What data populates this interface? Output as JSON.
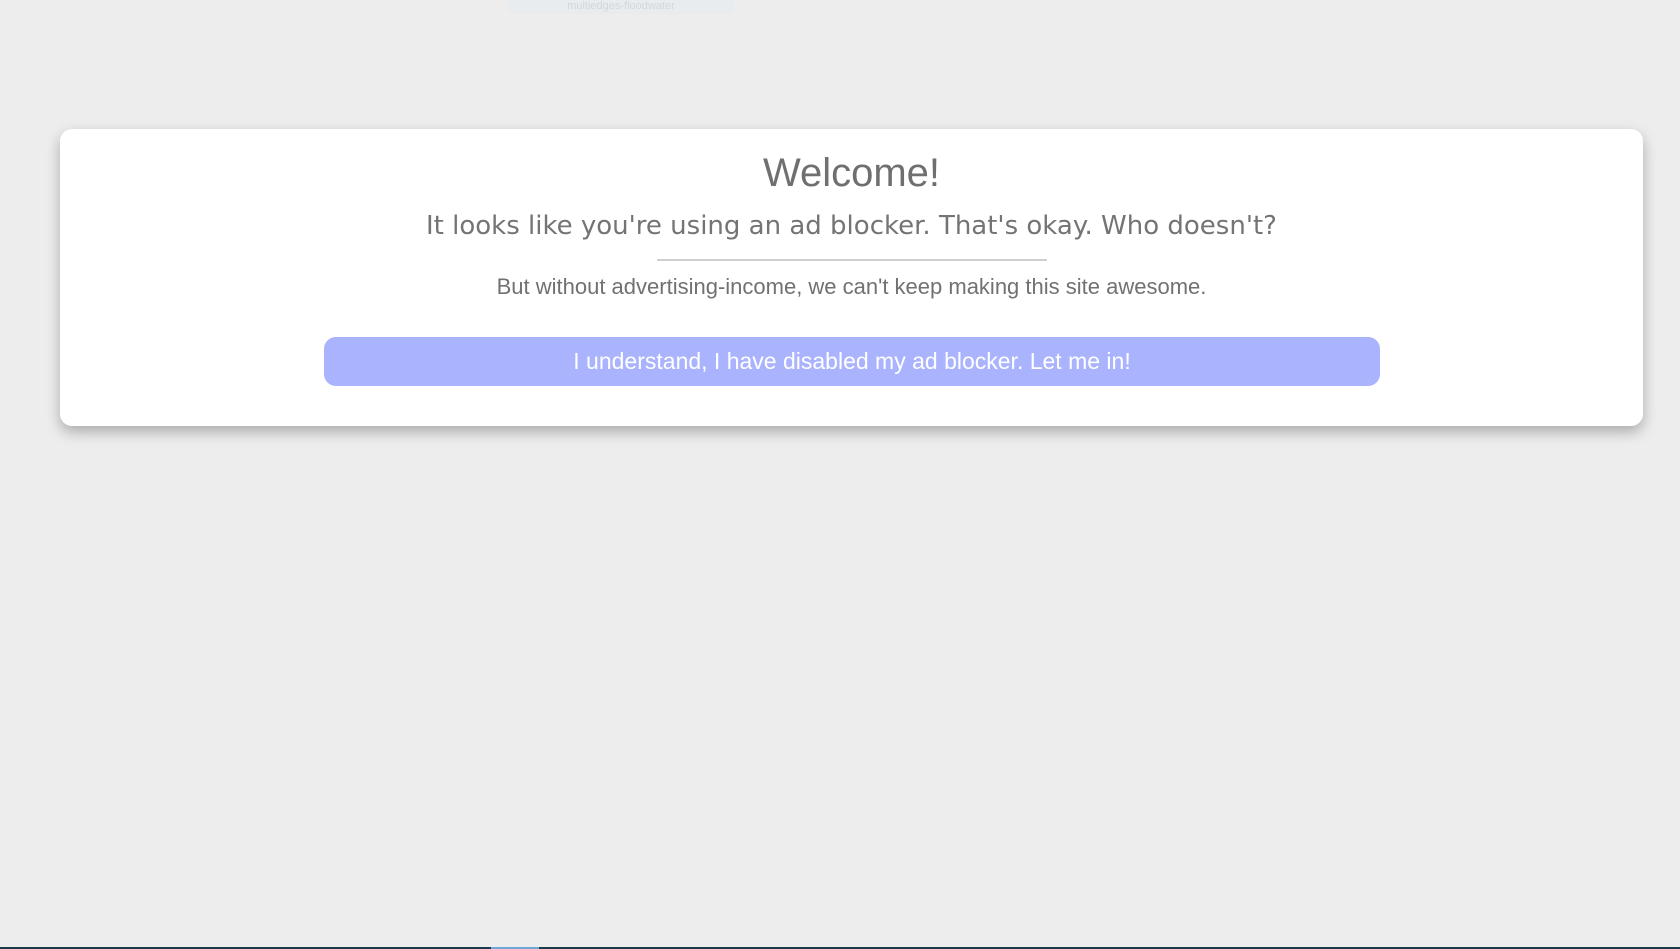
{
  "background_tab": {
    "label": "multiedges-floodwater"
  },
  "modal": {
    "title": "Welcome!",
    "subtitle": "It looks like you're using an ad blocker. That's okay. Who doesn't?",
    "message": "But without advertising-income, we can't keep making this site awesome.",
    "button_label": "I understand, I have disabled my ad blocker. Let me in!"
  },
  "colors": {
    "page_background": "#ededed",
    "modal_background": "#ffffff",
    "button_background": "#aab3fd",
    "button_text": "#ffffff",
    "text_primary": "#6f6f6f"
  }
}
